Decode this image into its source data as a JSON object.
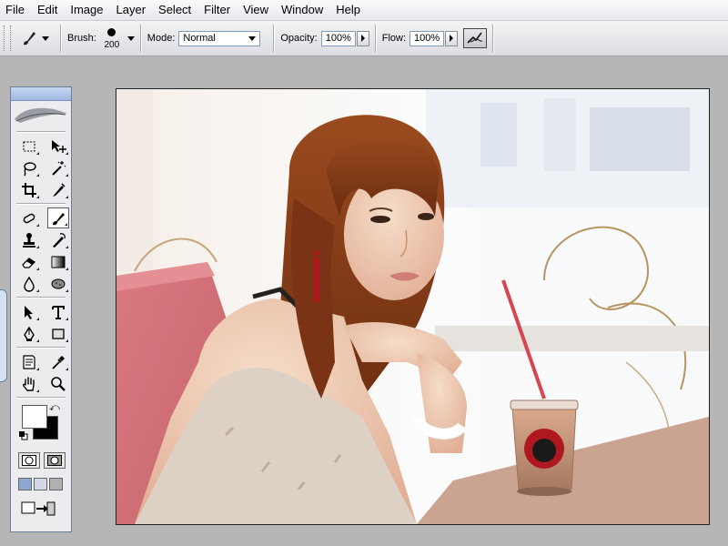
{
  "menu": [
    "File",
    "Edit",
    "Image",
    "Layer",
    "Select",
    "Filter",
    "View",
    "Window",
    "Help"
  ],
  "options": {
    "brush_label": "Brush:",
    "brush_size": "200",
    "mode_label": "Mode:",
    "mode_value": "Normal",
    "opacity_label": "Opacity:",
    "opacity_value": "100%",
    "flow_label": "Flow:",
    "flow_value": "100%"
  },
  "toolbox": {
    "tools": [
      "marquee-tool",
      "move-tool",
      "lasso-tool",
      "magic-wand-tool",
      "crop-tool",
      "slice-tool",
      "healing-brush-tool",
      "brush-tool",
      "clone-stamp-tool",
      "history-brush-tool",
      "eraser-tool",
      "gradient-tool",
      "blur-tool",
      "dodge-tool",
      "path-selection-tool",
      "type-tool",
      "pen-tool",
      "shape-tool",
      "notes-tool",
      "eyedropper-tool",
      "hand-tool",
      "zoom-tool"
    ],
    "active_tool": "brush-tool",
    "foreground_color": "#ffffff",
    "background_color": "#000000"
  },
  "document": {
    "content": "photo"
  },
  "colors": {
    "accent": "#9fb9e2",
    "workspace": "#b6b6b6"
  }
}
